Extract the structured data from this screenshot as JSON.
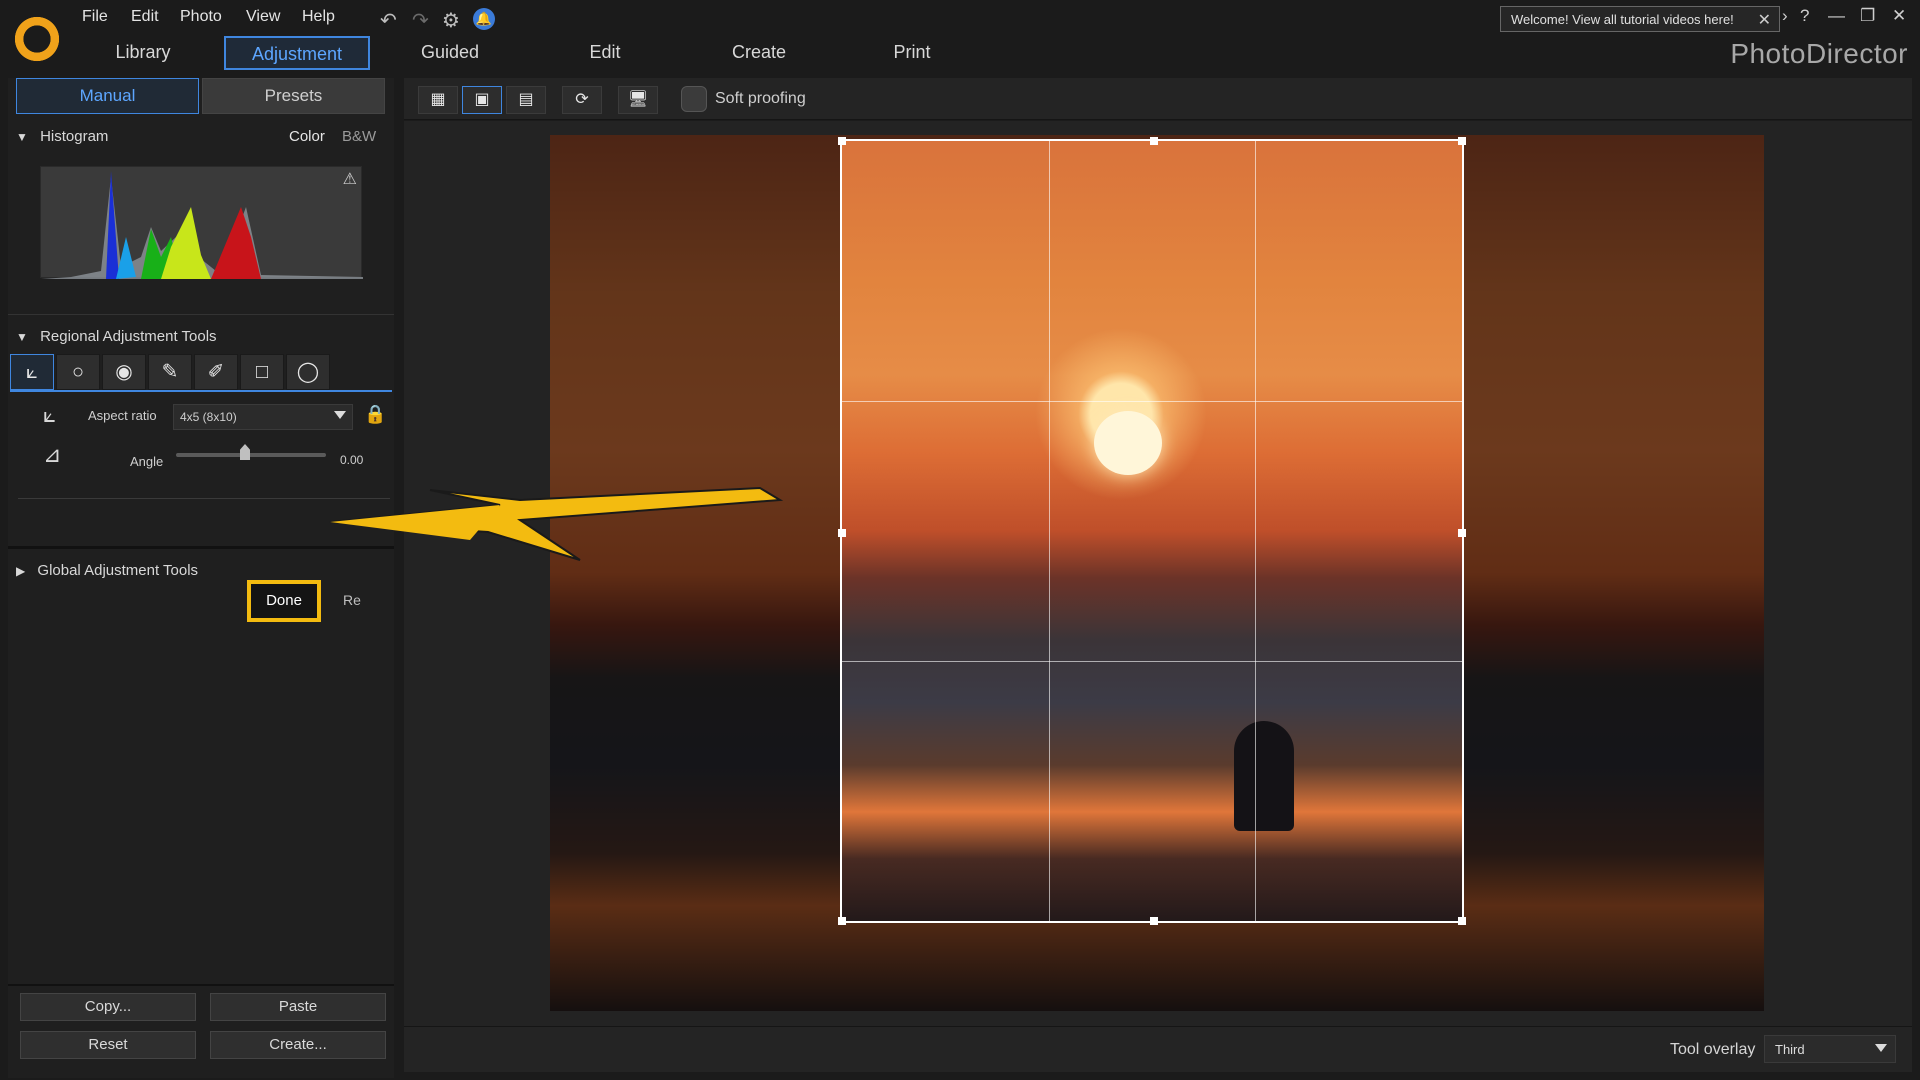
{
  "app": {
    "brand": "PhotoDirector",
    "menu": [
      "File",
      "Edit",
      "Photo",
      "View",
      "Help"
    ],
    "welcome_text": "Welcome! View all tutorial videos here!",
    "window_controls": [
      "?",
      "—",
      "❐",
      "✕"
    ]
  },
  "nav": {
    "tabs": [
      {
        "label": "Library",
        "active": false
      },
      {
        "label": "Adjustment",
        "active": true
      },
      {
        "label": "Guided",
        "active": false
      },
      {
        "label": "Edit",
        "active": false
      },
      {
        "label": "Create",
        "active": false
      },
      {
        "label": "Print",
        "active": false
      }
    ]
  },
  "left": {
    "subtabs": {
      "manual": "Manual",
      "presets": "Presets"
    },
    "histogram": {
      "title": "Histogram",
      "color": "Color",
      "bw": "B&W"
    },
    "regional": {
      "title": "Regional Adjustment Tools",
      "aspect_label": "Aspect ratio",
      "aspect_value": "4x5 (8x10)",
      "angle_label": "Angle",
      "angle_value": "0.00",
      "done": "Done",
      "reset_cut": "Re"
    },
    "global": {
      "title": "Global Adjustment Tools"
    },
    "buttons": {
      "copy": "Copy...",
      "paste": "Paste",
      "reset": "Reset",
      "create": "Create..."
    }
  },
  "toolbar": {
    "soft_proofing": "Soft proofing"
  },
  "bottom": {
    "tool_overlay_label": "Tool overlay",
    "tool_overlay_value": "Third"
  },
  "colors": {
    "accent": "#3f86df",
    "highlight": "#f3bb10"
  }
}
